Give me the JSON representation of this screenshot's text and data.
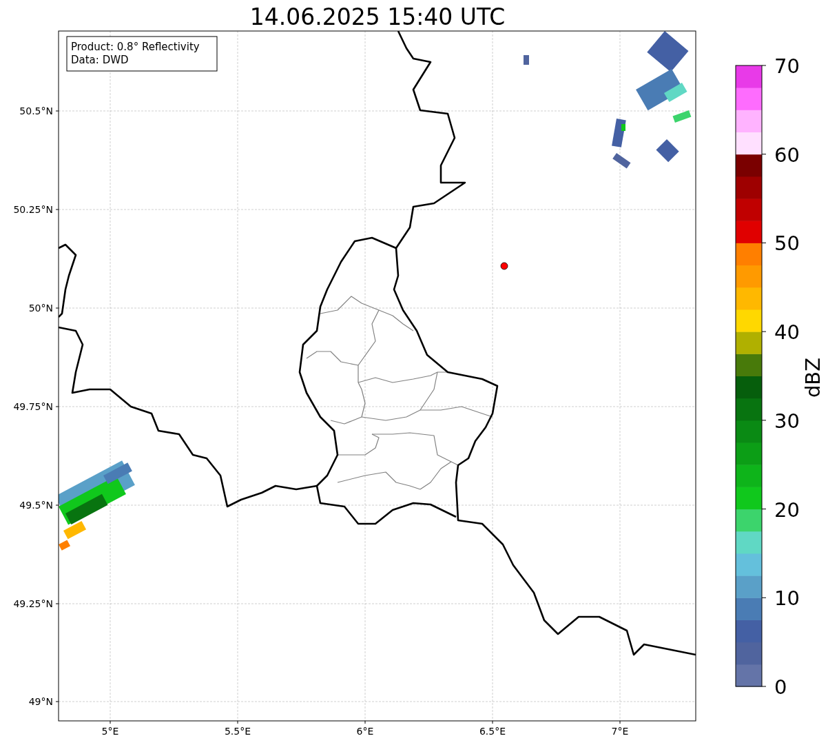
{
  "title": "14.06.2025 15:40 UTC",
  "info_box": {
    "lines": [
      "Product: 0.8° Reflectivity",
      "Data: DWD"
    ]
  },
  "lon_ticks": [
    "5°E",
    "5.5°E",
    "6°E",
    "6.5°E",
    "7°E"
  ],
  "lat_ticks": [
    "50.5°N",
    "50.25°N",
    "50°N",
    "49.75°N",
    "49.5°N",
    "49.25°N",
    "49°N"
  ],
  "colorbar": {
    "label": "dBZ",
    "ticks": [
      "70",
      "60",
      "50",
      "40",
      "30",
      "20",
      "10",
      "0"
    ],
    "bins": [
      {
        "color": "#6474a8"
      },
      {
        "color": "#50649e"
      },
      {
        "color": "#4460a4"
      },
      {
        "color": "#4a7cb4"
      },
      {
        "color": "#5aa0c8"
      },
      {
        "color": "#64c0dc"
      },
      {
        "color": "#60d8c4"
      },
      {
        "color": "#3cd46c"
      },
      {
        "color": "#10c81c"
      },
      {
        "color": "#0eb41a"
      },
      {
        "color": "#0c9e16"
      },
      {
        "color": "#0a8a14"
      },
      {
        "color": "#087410"
      },
      {
        "color": "#065e0c"
      },
      {
        "color": "#487a0a"
      },
      {
        "color": "#b0b000"
      },
      {
        "color": "#ffd800"
      },
      {
        "color": "#ffb800"
      },
      {
        "color": "#ff9a00"
      },
      {
        "color": "#ff7f00"
      },
      {
        "color": "#e00000"
      },
      {
        "color": "#c00000"
      },
      {
        "color": "#9e0000"
      },
      {
        "color": "#7a0000"
      },
      {
        "color": "#ffe0ff"
      },
      {
        "color": "#ffb3ff"
      },
      {
        "color": "#fe6cfe"
      },
      {
        "color": "#e83ae8"
      }
    ]
  }
}
